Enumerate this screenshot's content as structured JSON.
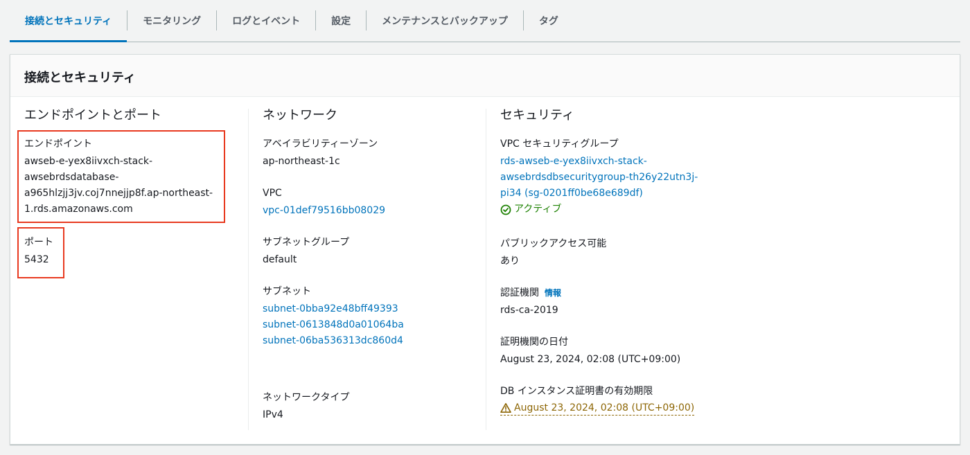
{
  "tabs": [
    {
      "label": "接続とセキュリティ",
      "active": true
    },
    {
      "label": "モニタリング"
    },
    {
      "label": "ログとイベント"
    },
    {
      "label": "設定"
    },
    {
      "label": "メンテナンスとバックアップ"
    },
    {
      "label": "タグ"
    }
  ],
  "panel": {
    "title": "接続とセキュリティ"
  },
  "endpoint_section": {
    "title": "エンドポイントとポート",
    "endpoint_label": "エンドポイント",
    "endpoint_lines": [
      "awseb-e-yex8iivxch-stack-",
      "awsebrdsdatabase-",
      "a965hlzjj3jv.coj7nnejjp8f.ap-northeast-",
      "1.rds.amazonaws.com"
    ],
    "port_label": "ポート",
    "port_value": "5432"
  },
  "network_section": {
    "title": "ネットワーク",
    "az_label": "アベイラビリティーゾーン",
    "az_value": "ap-northeast-1c",
    "vpc_label": "VPC",
    "vpc_value": "vpc-01def79516bb08029",
    "subnet_group_label": "サブネットグループ",
    "subnet_group_value": "default",
    "subnets_label": "サブネット",
    "subnets": [
      "subnet-0bba92e48bff49393",
      "subnet-0613848d0a01064ba",
      "subnet-06ba536313dc860d4"
    ],
    "network_type_label": "ネットワークタイプ",
    "network_type_value": "IPv4"
  },
  "security_section": {
    "title": "セキュリティ",
    "sg_label": "VPC セキュリティグループ",
    "sg_lines": [
      "rds-awseb-e-yex8iivxch-stack-",
      "awsebrdsdbsecuritygroup-th26y22utn3j-",
      "pi34 (sg-0201ff0be68e689df)"
    ],
    "sg_status": "アクティブ",
    "public_access_label": "パブリックアクセス可能",
    "public_access_value": "あり",
    "ca_label": "認証機関",
    "ca_info": "情報",
    "ca_value": "rds-ca-2019",
    "ca_date_label": "証明機関の日付",
    "ca_date_value": "August 23, 2024, 02:08 (UTC+09:00)",
    "cert_expiry_label": "DB インスタンス証明書の有効期限",
    "cert_expiry_value": "August 23, 2024, 02:08 (UTC+09:00)"
  },
  "colors": {
    "accent": "#0073bb",
    "success": "#1d8102",
    "warning": "#8d6605",
    "highlight": "#e8391f"
  }
}
